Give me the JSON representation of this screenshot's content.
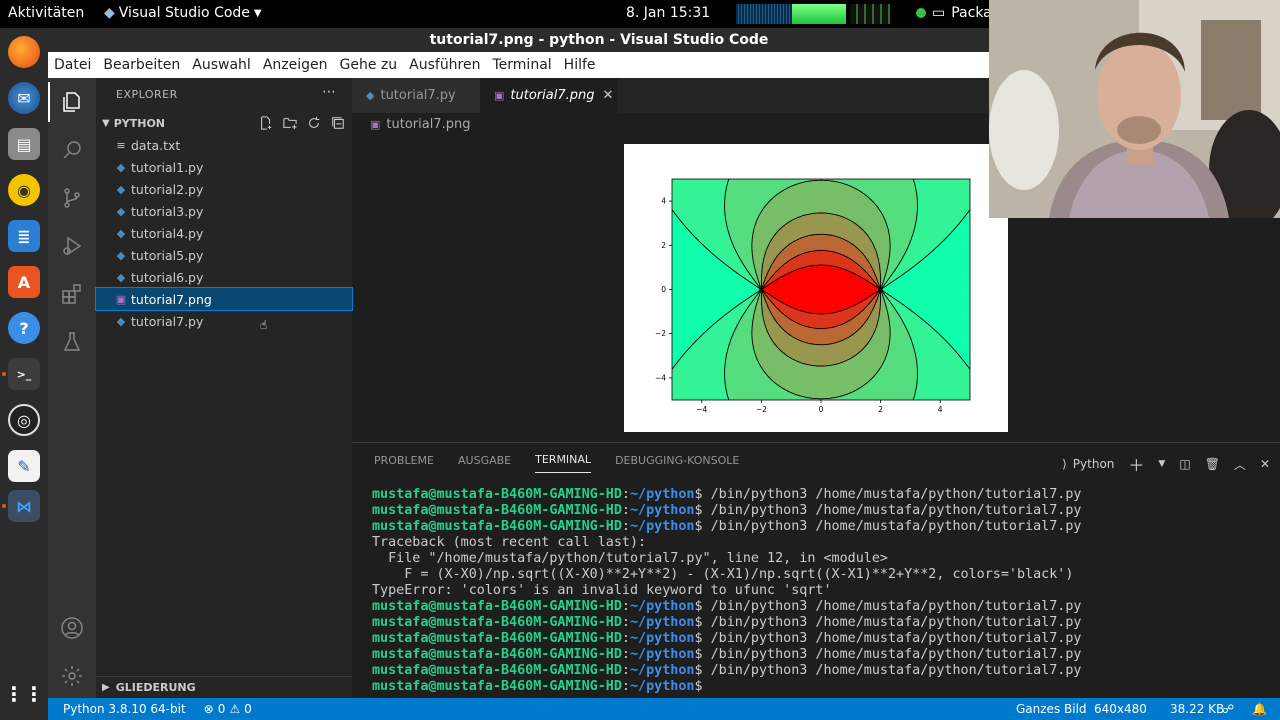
{
  "topbar": {
    "activities": "Aktivitäten",
    "app_menu": "Visual Studio Code",
    "clock": "8. Jan  15:31",
    "package": "Packa"
  },
  "window": {
    "title": "tutorial7.png - python - Visual Studio Code"
  },
  "menu": [
    "Datei",
    "Bearbeiten",
    "Auswahl",
    "Anzeigen",
    "Gehe zu",
    "Ausführen",
    "Terminal",
    "Hilfe"
  ],
  "explorer": {
    "header": "EXPLORER",
    "folder": "PYTHON",
    "files": [
      "data.txt",
      "tutorial1.py",
      "tutorial2.py",
      "tutorial3.py",
      "tutorial4.py",
      "tutorial5.py",
      "tutorial6.py",
      "tutorial7.png",
      "tutorial7.py"
    ],
    "selected": "tutorial7.png",
    "outline": "GLIEDERUNG"
  },
  "tabs": [
    {
      "label": "tutorial7.py",
      "active": false
    },
    {
      "label": "tutorial7.png",
      "active": true
    }
  ],
  "breadcrumb": "tutorial7.png",
  "chart_data": {
    "type": "contour",
    "x_ticks": [
      "−4",
      "−2",
      "0",
      "2",
      "4"
    ],
    "y_ticks": [
      "4",
      "2",
      "0",
      "−2",
      "−4"
    ],
    "xlim": [
      -5,
      5
    ],
    "ylim": [
      -5,
      5
    ],
    "singular_points": [
      [
        -2,
        0
      ],
      [
        2,
        0
      ]
    ],
    "colormap": "rainbow"
  },
  "panel": {
    "tabs": [
      "PROBLEME",
      "AUSGABE",
      "TERMINAL",
      "DEBUGGING-KONSOLE"
    ],
    "active_tab": "TERMINAL",
    "shell": "Python"
  },
  "terminal": {
    "user": "mustafa@mustafa-B460M-GAMING-HD",
    "cwd": "~/python",
    "lines": [
      {
        "type": "prompt",
        "cmd": "/bin/python3 /home/mustafa/python/tutorial7.py"
      },
      {
        "type": "prompt",
        "cmd": "/bin/python3 /home/mustafa/python/tutorial7.py"
      },
      {
        "type": "prompt",
        "cmd": "/bin/python3 /home/mustafa/python/tutorial7.py"
      },
      {
        "type": "text",
        "text": "Traceback (most recent call last):"
      },
      {
        "type": "text",
        "text": "  File \"/home/mustafa/python/tutorial7.py\", line 12, in <module>"
      },
      {
        "type": "text",
        "text": "    F = (X-X0)/np.sqrt((X-X0)**2+Y**2) - (X-X1)/np.sqrt((X-X1)**2+Y**2, colors='black')"
      },
      {
        "type": "text",
        "text": "TypeError: 'colors' is an invalid keyword to ufunc 'sqrt'"
      },
      {
        "type": "prompt",
        "cmd": "/bin/python3 /home/mustafa/python/tutorial7.py"
      },
      {
        "type": "prompt",
        "cmd": "/bin/python3 /home/mustafa/python/tutorial7.py"
      },
      {
        "type": "prompt",
        "cmd": "/bin/python3 /home/mustafa/python/tutorial7.py"
      },
      {
        "type": "prompt",
        "cmd": "/bin/python3 /home/mustafa/python/tutorial7.py"
      },
      {
        "type": "prompt",
        "cmd": "/bin/python3 /home/mustafa/python/tutorial7.py"
      },
      {
        "type": "prompt",
        "cmd": ""
      }
    ]
  },
  "status": {
    "interpreter": "Python 3.8.10 64-bit",
    "errors": "0",
    "warnings": "0",
    "zoom": "Ganzes Bild",
    "dimensions": "640x480",
    "size": "38.22 KB"
  }
}
